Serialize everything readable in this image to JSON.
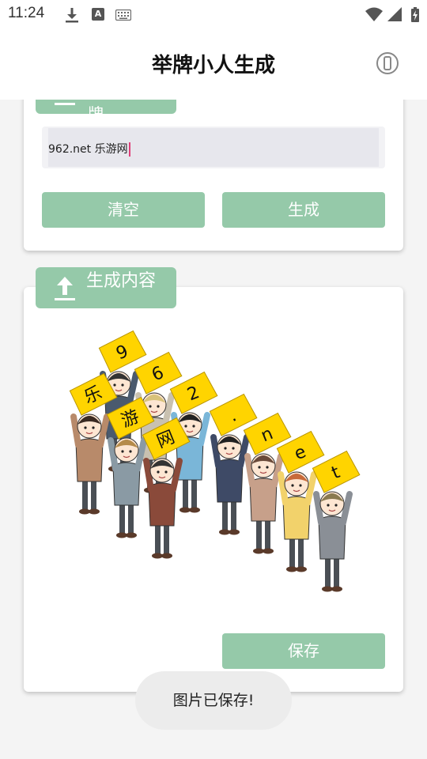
{
  "status_bar": {
    "time": "11:24",
    "icons": [
      "download-icon",
      "font-icon",
      "keyboard-icon",
      "wifi-icon",
      "signal-icon",
      "battery-charging-icon"
    ],
    "font_icon_letter": "A"
  },
  "app_bar": {
    "title": "举牌小人生成",
    "info_icon": "info-icon"
  },
  "input_card": {
    "tag_label": "牌",
    "input_value": "962.net 乐游网",
    "clear_label": "清空",
    "generate_label": "生成"
  },
  "output_card": {
    "tag_icon": "upload-icon",
    "tag_label": "生成内容",
    "sign_characters": [
      "9",
      "6",
      "2",
      "乐",
      "游",
      "网",
      ".",
      "n",
      "e",
      "t"
    ],
    "save_label": "保存"
  },
  "toast": {
    "message": "图片已保存!"
  },
  "colors": {
    "accent": "#95c9a9",
    "sign_yellow": "#ffd400",
    "background": "#f4f4f4",
    "card": "#ffffff"
  }
}
